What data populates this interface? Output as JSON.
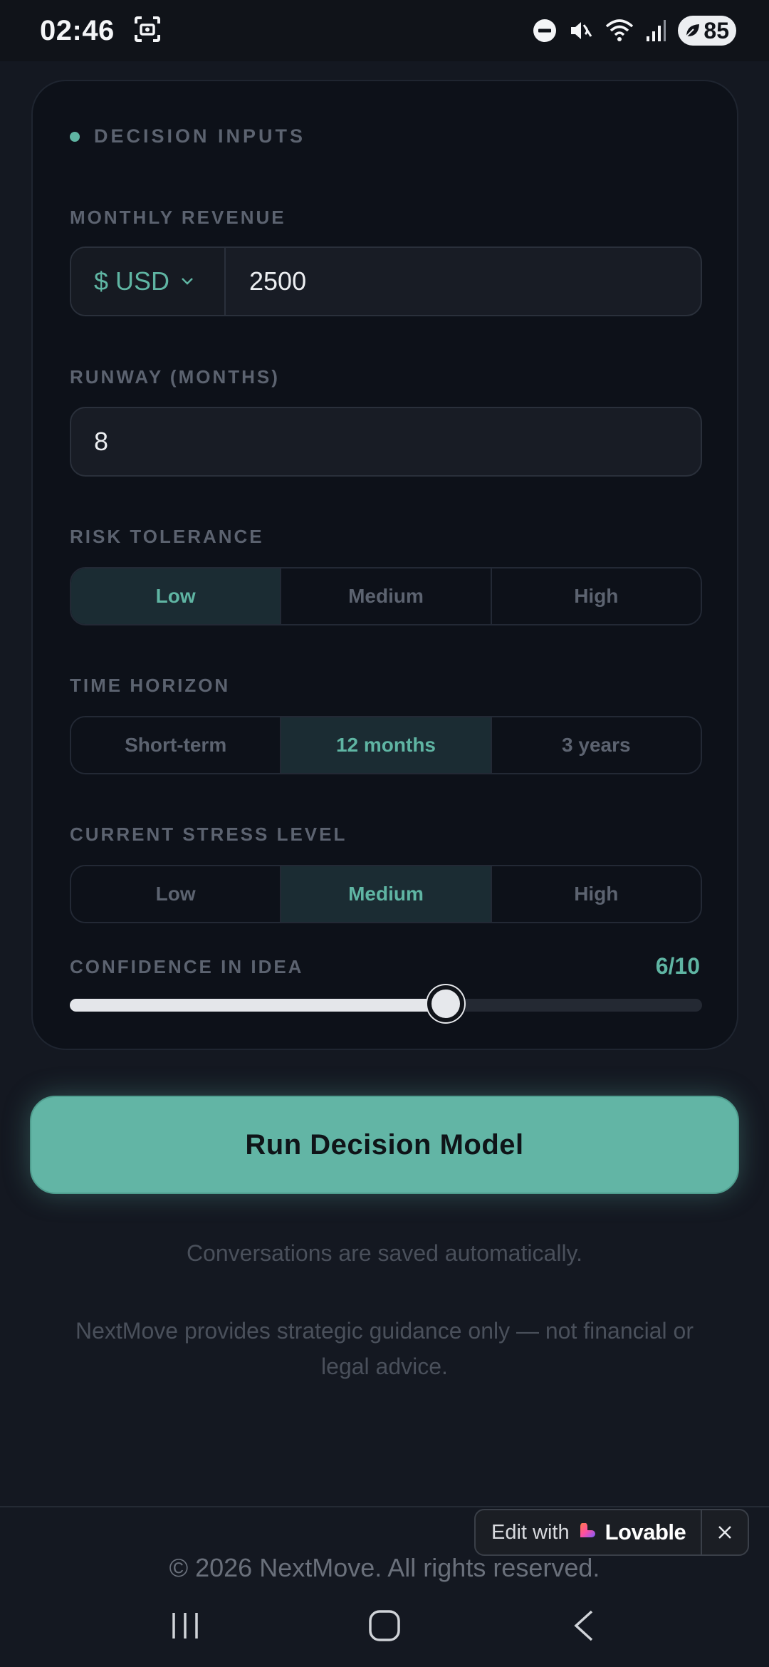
{
  "status_bar": {
    "time": "02:46",
    "battery": "85"
  },
  "card": {
    "section_title": "DECISION INPUTS",
    "monthly_revenue": {
      "label": "MONTHLY REVENUE",
      "currency": "$ USD",
      "value": "2500"
    },
    "runway": {
      "label": "RUNWAY (MONTHS)",
      "value": "8"
    },
    "risk_tolerance": {
      "label": "RISK TOLERANCE",
      "options": [
        "Low",
        "Medium",
        "High"
      ],
      "selected": "Low"
    },
    "time_horizon": {
      "label": "TIME HORIZON",
      "options": [
        "Short-term",
        "12 months",
        "3 years"
      ],
      "selected": "12 months"
    },
    "stress_level": {
      "label": "CURRENT STRESS LEVEL",
      "options": [
        "Low",
        "Medium",
        "High"
      ],
      "selected": "Medium"
    },
    "confidence": {
      "label": "CONFIDENCE IN IDEA",
      "display": "6/10",
      "value": 6,
      "max": 10
    }
  },
  "run_button": "Run Decision Model",
  "notes": {
    "autosave": "Conversations are saved automatically.",
    "disclaimer_line1": "NextMove provides strategic guidance only — not financial or",
    "disclaimer_line2": "legal advice."
  },
  "footer": {
    "copyright": "© 2026 NextMove. All rights reserved."
  },
  "lovable_badge": {
    "edit_with": "Edit with",
    "brand": "Lovable"
  },
  "colors": {
    "accent": "#5fb5a3",
    "button": "#62b5a5",
    "background": "#141821",
    "card": "#0d1119"
  }
}
